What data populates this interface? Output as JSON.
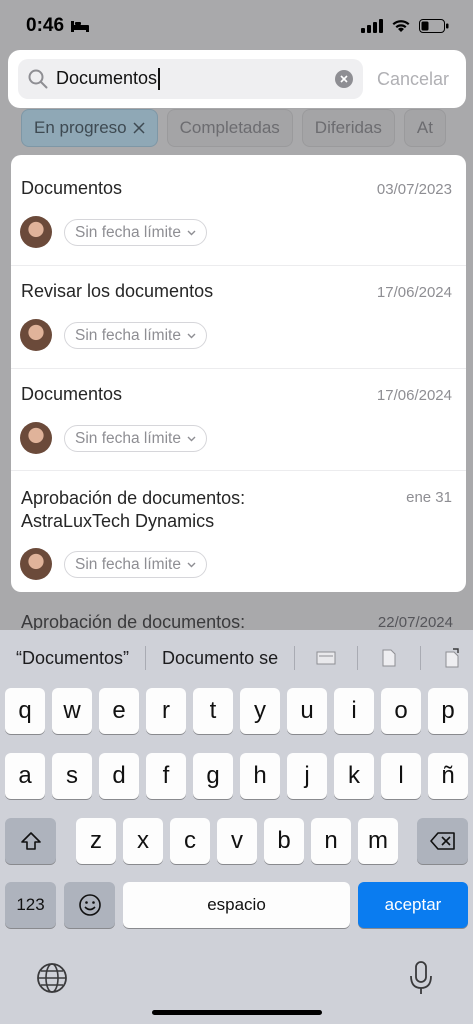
{
  "status": {
    "time": "0:46"
  },
  "search": {
    "value": "Documentos",
    "cancel_label": "Cancelar"
  },
  "filters": [
    {
      "label": "En progreso",
      "active": true
    },
    {
      "label": "Completadas",
      "active": false
    },
    {
      "label": "Diferidas",
      "active": false
    },
    {
      "label": "At",
      "active": false
    }
  ],
  "results": [
    {
      "title": "Documentos",
      "date": "03/07/2023",
      "deadline": "Sin fecha límite"
    },
    {
      "title": "Revisar los documentos",
      "date": "17/06/2024",
      "deadline": "Sin fecha límite"
    },
    {
      "title": "Documentos",
      "date": "17/06/2024",
      "deadline": "Sin fecha límite"
    },
    {
      "title": "Aprobación de documentos: AstraLuxTech Dynamics",
      "date": "ene 31",
      "deadline": "Sin fecha límite"
    }
  ],
  "background_item": {
    "title": "Aprobación de documentos:",
    "date": "22/07/2024"
  },
  "keyboard": {
    "suggestions": [
      "“Documentos”",
      "Documento se"
    ],
    "row1": [
      "q",
      "w",
      "e",
      "r",
      "t",
      "y",
      "u",
      "i",
      "o",
      "p"
    ],
    "row2": [
      "a",
      "s",
      "d",
      "f",
      "g",
      "h",
      "j",
      "k",
      "l",
      "ñ"
    ],
    "row3": [
      "z",
      "x",
      "c",
      "v",
      "b",
      "n",
      "m"
    ],
    "numbers_label": "123",
    "space_label": "espacio",
    "return_label": "aceptar"
  },
  "colors": {
    "accent": "#0a7cf0",
    "chip_active": "#8fa8b6"
  }
}
